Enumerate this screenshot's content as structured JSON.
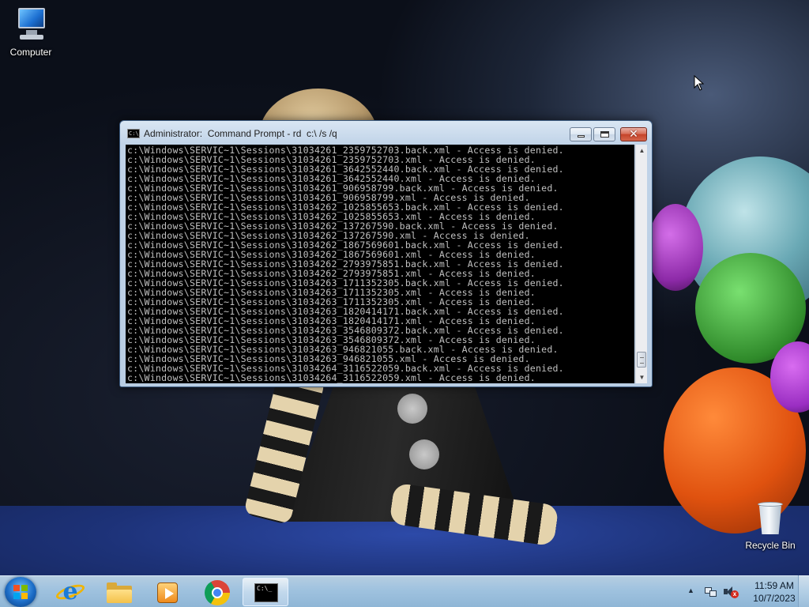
{
  "desktop": {
    "icons": [
      {
        "label": "Computer",
        "icon": "computer-icon"
      },
      {
        "label": "Recycle Bin",
        "icon": "recycle-bin-icon"
      }
    ]
  },
  "cmd_window": {
    "title": "Administrator:  Command Prompt - rd  c:\\ /s /q",
    "icon": "command-prompt-icon",
    "icon_text": "C:\\_",
    "close_label": "✕",
    "lines": [
      "c:\\Windows\\SERVIC~1\\Sessions\\31034261_2359752703.back.xml - Access is denied.",
      "c:\\Windows\\SERVIC~1\\Sessions\\31034261_2359752703.xml - Access is denied.",
      "c:\\Windows\\SERVIC~1\\Sessions\\31034261_3642552440.back.xml - Access is denied.",
      "c:\\Windows\\SERVIC~1\\Sessions\\31034261_3642552440.xml - Access is denied.",
      "c:\\Windows\\SERVIC~1\\Sessions\\31034261_906958799.back.xml - Access is denied.",
      "c:\\Windows\\SERVIC~1\\Sessions\\31034261_906958799.xml - Access is denied.",
      "c:\\Windows\\SERVIC~1\\Sessions\\31034262_1025855653.back.xml - Access is denied.",
      "c:\\Windows\\SERVIC~1\\Sessions\\31034262_1025855653.xml - Access is denied.",
      "c:\\Windows\\SERVIC~1\\Sessions\\31034262_137267590.back.xml - Access is denied.",
      "c:\\Windows\\SERVIC~1\\Sessions\\31034262_137267590.xml - Access is denied.",
      "c:\\Windows\\SERVIC~1\\Sessions\\31034262_1867569601.back.xml - Access is denied.",
      "c:\\Windows\\SERVIC~1\\Sessions\\31034262_1867569601.xml - Access is denied.",
      "c:\\Windows\\SERVIC~1\\Sessions\\31034262_2793975851.back.xml - Access is denied.",
      "c:\\Windows\\SERVIC~1\\Sessions\\31034262_2793975851.xml - Access is denied.",
      "c:\\Windows\\SERVIC~1\\Sessions\\31034263_1711352305.back.xml - Access is denied.",
      "c:\\Windows\\SERVIC~1\\Sessions\\31034263_1711352305.xml - Access is denied.",
      "c:\\Windows\\SERVIC~1\\Sessions\\31034263_1711352305.xml - Access is denied.",
      "c:\\Windows\\SERVIC~1\\Sessions\\31034263_1820414171.back.xml - Access is denied.",
      "c:\\Windows\\SERVIC~1\\Sessions\\31034263_1820414171.xml - Access is denied.",
      "c:\\Windows\\SERVIC~1\\Sessions\\31034263_3546809372.back.xml - Access is denied.",
      "c:\\Windows\\SERVIC~1\\Sessions\\31034263_3546809372.xml - Access is denied.",
      "c:\\Windows\\SERVIC~1\\Sessions\\31034263_946821055.back.xml - Access is denied.",
      "c:\\Windows\\SERVIC~1\\Sessions\\31034263_946821055.xml - Access is denied.",
      "c:\\Windows\\SERVIC~1\\Sessions\\31034264_3116522059.back.xml - Access is denied.",
      "c:\\Windows\\SERVIC~1\\Sessions\\31034264_3116522059.xml - Access is denied."
    ]
  },
  "taskbar": {
    "start_icon": "windows-start-icon",
    "pinned": [
      {
        "name": "internet-explorer-icon",
        "glyph": "e"
      },
      {
        "name": "windows-explorer-icon"
      },
      {
        "name": "windows-media-player-icon"
      },
      {
        "name": "google-chrome-icon"
      },
      {
        "name": "command-prompt-icon",
        "glyph": "C:\\_",
        "active": true
      }
    ],
    "tray": {
      "overflow_glyph": "▲",
      "icons": [
        "network-icon",
        "volume-muted-icon"
      ],
      "mute_glyph": "x",
      "time": "11:59 AM",
      "date": "10/7/2023"
    }
  },
  "colors": {
    "console_background": "#000000",
    "console_text": "#c0c0c0",
    "close_button": "#c6452b",
    "taskbar": "#9fc2df"
  }
}
